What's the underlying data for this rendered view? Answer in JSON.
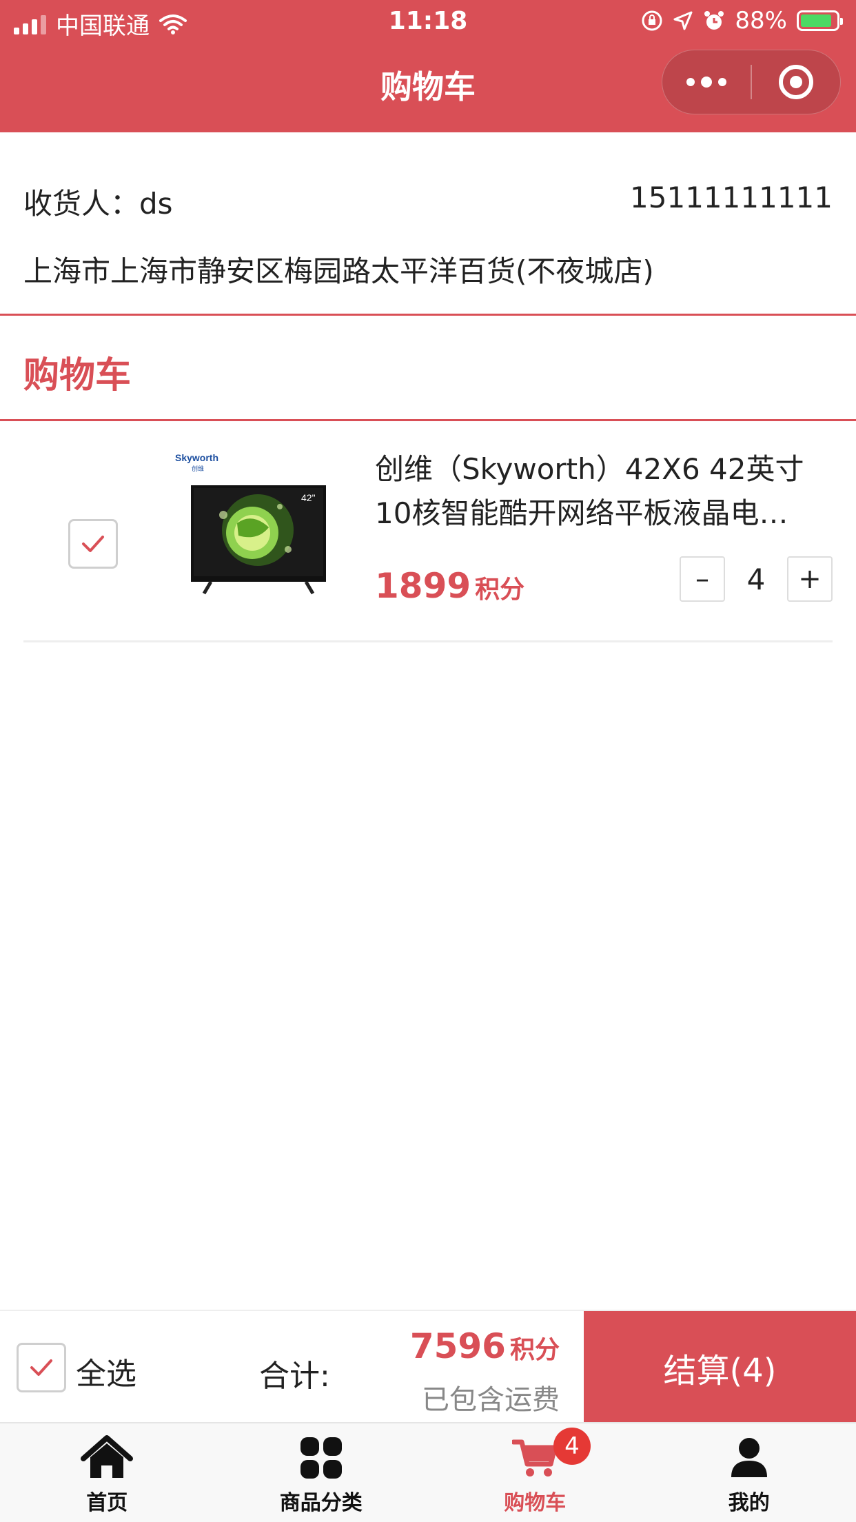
{
  "status_bar": {
    "carrier": "中国联通",
    "time": "11:18",
    "battery": "88%"
  },
  "nav": {
    "title": "购物车"
  },
  "address": {
    "receiver_label": "收货人：",
    "receiver_name": "ds",
    "phone": "15111111111",
    "full_address": "上海市上海市静安区梅园路太平洋百货(不夜城店)"
  },
  "cart": {
    "title": "购物车",
    "items": [
      {
        "name": "创维（Skyworth）42X6 42英寸10核智能酷开网络平板液晶电…",
        "image_brand": "Skyworth",
        "image_brand_cn": "创维",
        "image_size_label": "42\"",
        "price": "1899",
        "price_unit": "积分",
        "minus": "–",
        "quantity": "4",
        "plus": "+",
        "checked": true
      }
    ]
  },
  "checkout": {
    "select_all_label": "全选",
    "total_label": "合计:",
    "total_value": "7596",
    "total_unit": "积分",
    "shipping_note": "已包含运费",
    "pay_button": "结算(4)"
  },
  "tabbar": {
    "tabs": [
      {
        "label": "首页",
        "icon": "home-icon"
      },
      {
        "label": "商品分类",
        "icon": "category-grid-icon"
      },
      {
        "label": "购物车",
        "icon": "shopping-cart-icon",
        "badge": "4",
        "active": true
      },
      {
        "label": "我的",
        "icon": "user-icon"
      }
    ]
  },
  "colors": {
    "brand": "#d94f56",
    "badge": "#e53935",
    "battery": "#4cd964"
  }
}
